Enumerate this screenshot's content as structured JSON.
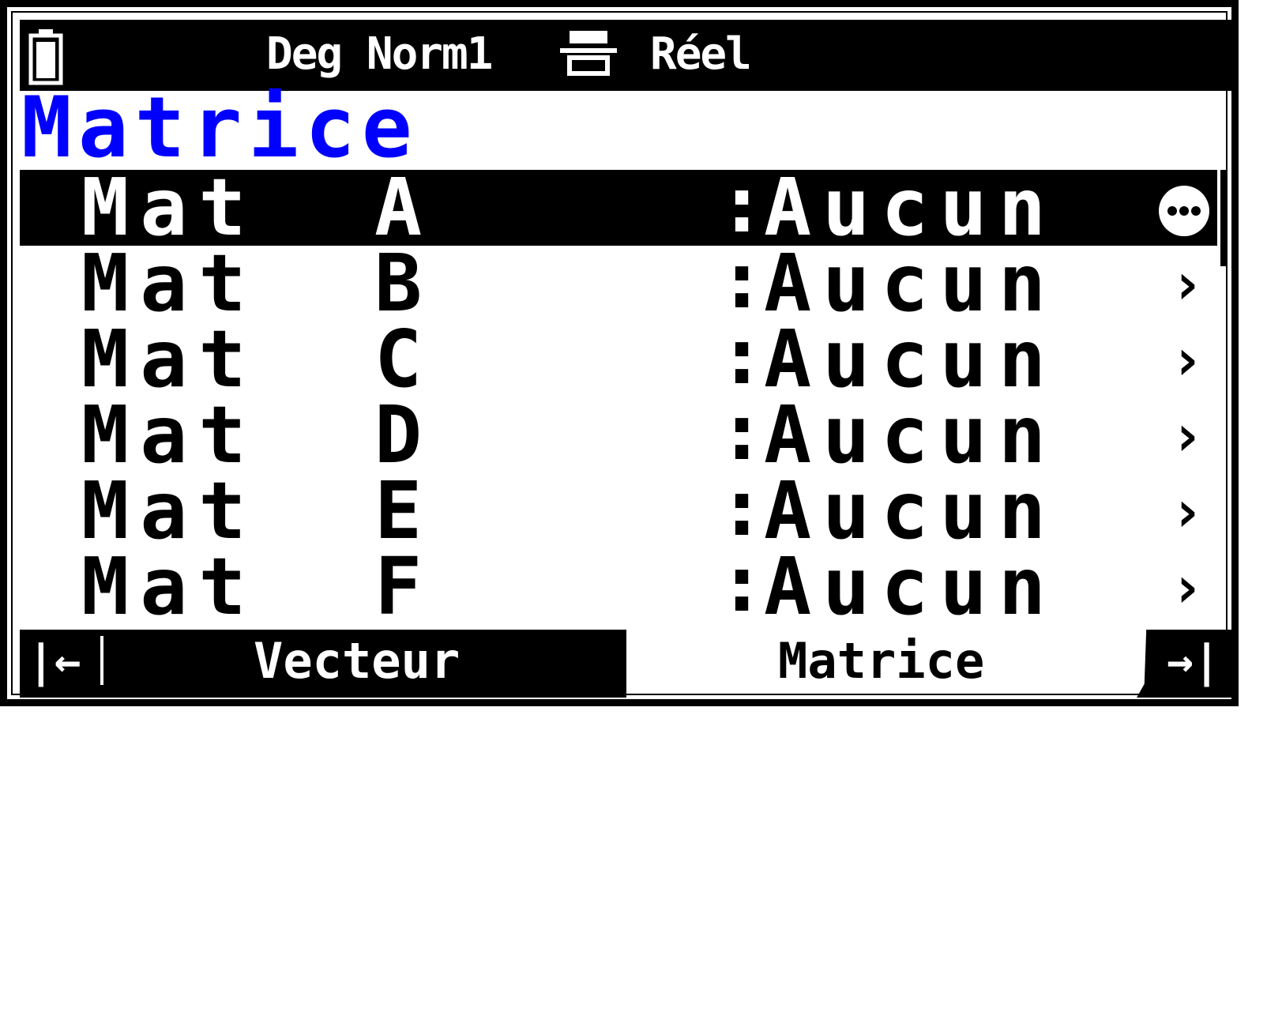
{
  "statusbar": {
    "mode": "Deg Norm1",
    "number_type": "Réel",
    "icons": {
      "battery": "battery-icon",
      "display": "natural-display-icon"
    }
  },
  "title": "Matrice",
  "rows": [
    {
      "name": "Mat  A",
      "sep": ":",
      "value": "Aucun"
    },
    {
      "name": "Mat  B",
      "sep": ":",
      "value": "Aucun"
    },
    {
      "name": "Mat  C",
      "sep": ":",
      "value": "Aucun"
    },
    {
      "name": "Mat  D",
      "sep": ":",
      "value": "Aucun"
    },
    {
      "name": "Mat  E",
      "sep": ":",
      "value": "Aucun"
    },
    {
      "name": "Mat  F",
      "sep": ":",
      "value": "Aucun"
    }
  ],
  "row_icons": {
    "selected": "more-options-icon",
    "other": "chevron-right-icon"
  },
  "chevron_glyph": "›",
  "selected_index": 0,
  "tabs": {
    "left_arrow": "|←",
    "left_label": "Vecteur",
    "current_label": "Matrice",
    "right_arrow": "→|"
  },
  "colors": {
    "title": "#0000ff",
    "bar": "#000000",
    "background": "#ffffff"
  }
}
